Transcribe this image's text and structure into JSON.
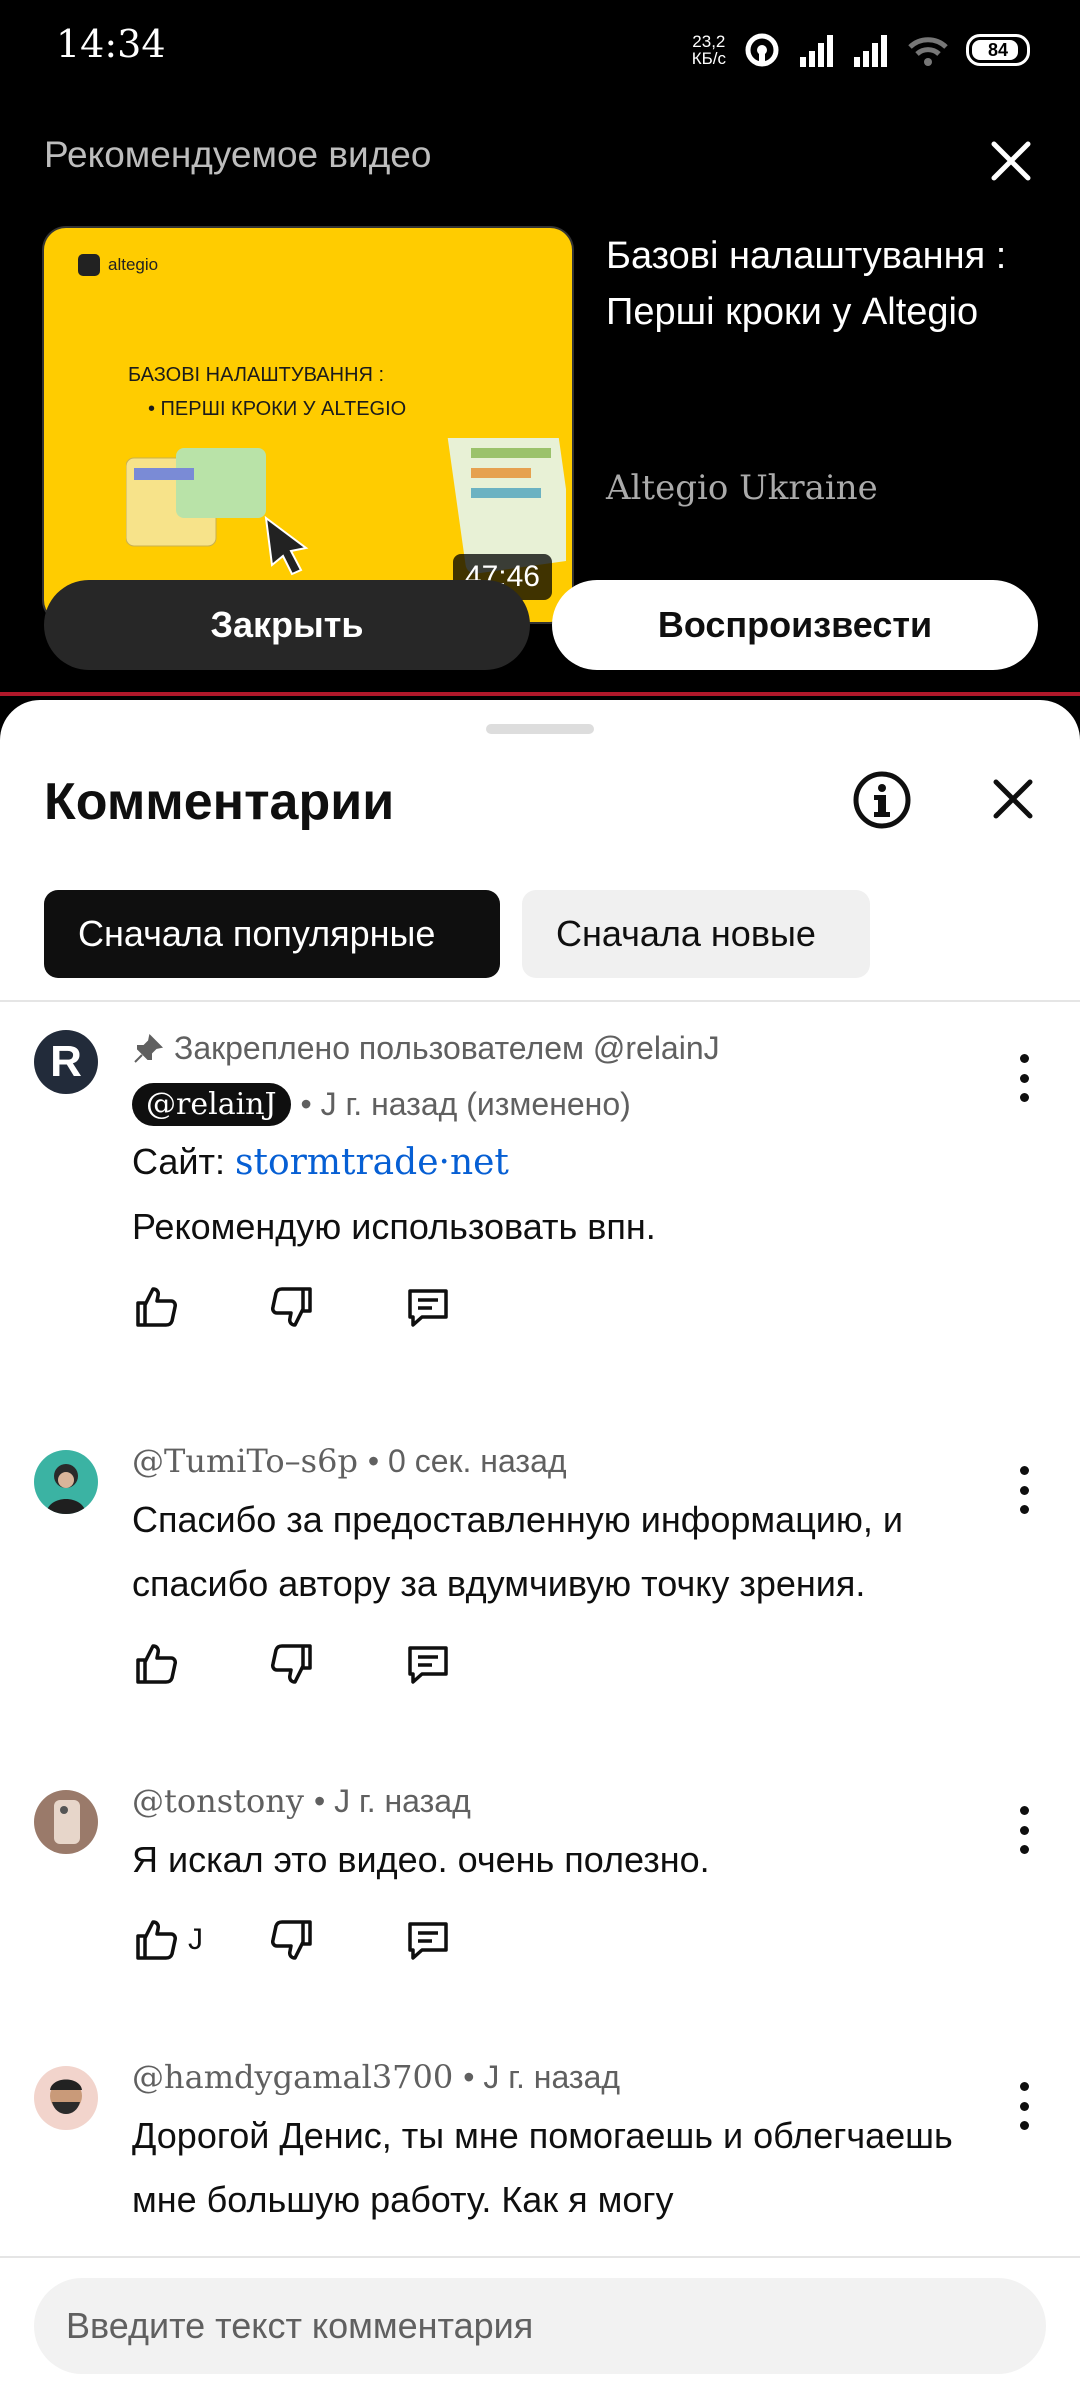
{
  "status_bar": {
    "time": "14:34",
    "net_speed_value": "23,2",
    "net_speed_unit": "КБ/с",
    "battery": "84"
  },
  "recommended": {
    "label": "Рекомендуемое видео",
    "thumbnail": {
      "logo_text": "altegio",
      "line1": "БАЗОВІ НАЛАШТУВАННЯ :",
      "line2": "• ПЕРШІ КРОКИ У ALTEGIO",
      "duration": "47:46"
    },
    "title": "Базові налаштування : Перші кроки у Altegio",
    "channel": "Altegio Ukraine",
    "close_button": "Закрыть",
    "play_button": "Воспроизвести"
  },
  "comments_panel": {
    "title": "Комментарии",
    "sort_tabs": [
      "Сначала популярные",
      "Сначала новые"
    ],
    "comments": [
      {
        "avatar_letter": "R",
        "pinned_label": "Закреплено пользователем @relainJ",
        "author": "@relainJ",
        "time": "• J г. назад (изменено)",
        "site_label": "Сайт:",
        "site_link": "stormtrade·net",
        "text": "Рекомендую использовать впн."
      },
      {
        "author": "@TumiTo–s6p",
        "time": "• 0 сек. назад",
        "text": "Спасибо за предоставленную информацию, и спасибо автору за вдумчивую точку зрения."
      },
      {
        "author": "@tonstony",
        "time": "• J г. назад",
        "text": "Я искал это видео. очень полезно.",
        "likes": "J"
      },
      {
        "author": "@hamdygamal3700",
        "time": "• J г. назад",
        "text": "Дорогой Денис, ты мне помогаешь и облегчаешь мне большую работу. Как я могу"
      }
    ],
    "composer_placeholder": "Введите текст комментария"
  }
}
